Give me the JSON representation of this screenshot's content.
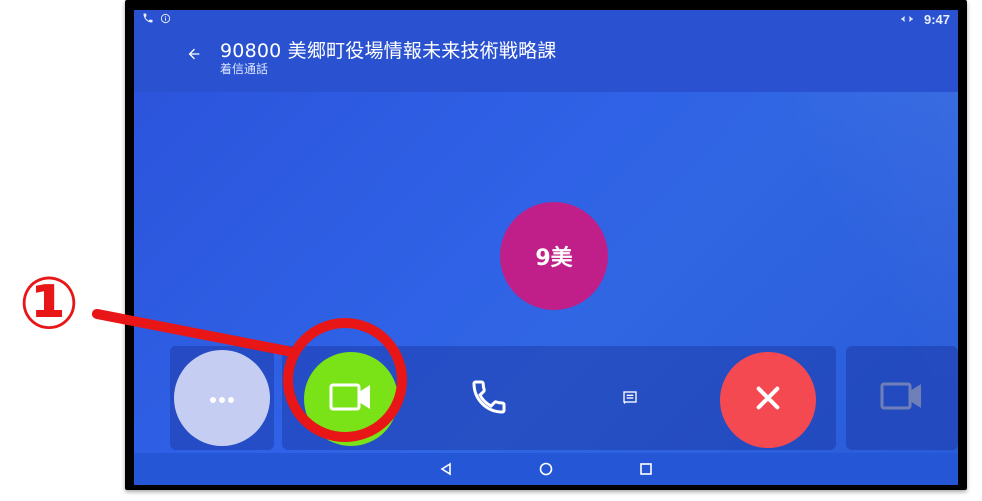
{
  "statusbar": {
    "time": "9:47"
  },
  "appbar": {
    "title": "90800 美郷町役場情報未来技術戦略課",
    "subtitle": "着信通話"
  },
  "caller": {
    "avatar_text": "9美"
  },
  "actions": {
    "more_icon": "more-horiz-icon",
    "answer_video_icon": "videocam-icon",
    "answer_audio_icon": "phone-icon",
    "message_icon": "message-icon",
    "decline_icon": "close-icon",
    "video_toggle_icon": "videocam-icon"
  },
  "nav": {
    "back": "back-icon",
    "home": "home-icon",
    "recents": "recents-icon"
  },
  "annotation": {
    "label": "①"
  },
  "colors": {
    "background": "#2f62e6",
    "avatar": "#c01f89",
    "answer_video": "#7ae317",
    "decline": "#f54952",
    "annotation": "#e81616"
  }
}
